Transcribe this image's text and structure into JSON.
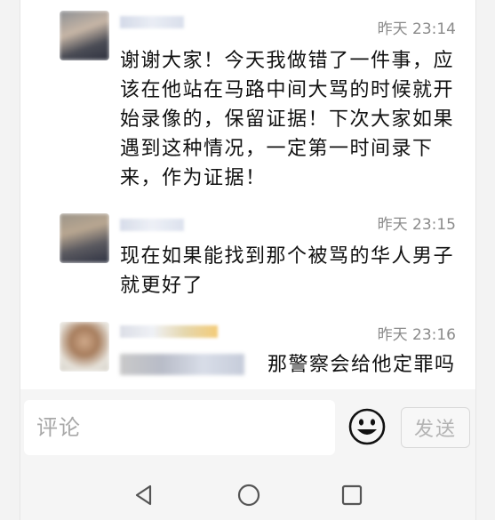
{
  "comments": [
    {
      "time": "昨天 23:14",
      "text": "谢谢大家！今天我做错了一件事，应该在他站在马路中间大骂的时候就开始录像的，保留证据！下次大家如果遇到这种情况，一定第一时间录下来，作为证据！"
    },
    {
      "time": "昨天 23:15",
      "text": "现在如果能找到那个被骂的华人男子就更好了"
    },
    {
      "time": "昨天 23:16",
      "text": "那警察会给他定罪吗"
    }
  ],
  "input": {
    "placeholder": "评论"
  },
  "send_label": "发送",
  "icons": {
    "emoji": "smiley-face-icon",
    "back": "triangle-back-icon",
    "home": "circle-home-icon",
    "recent": "square-recent-icon"
  },
  "colors": {
    "text": "#111111",
    "time": "#8a8a8a",
    "placeholder": "#a8a8a8",
    "send_disabled": "#b3b3b3"
  }
}
